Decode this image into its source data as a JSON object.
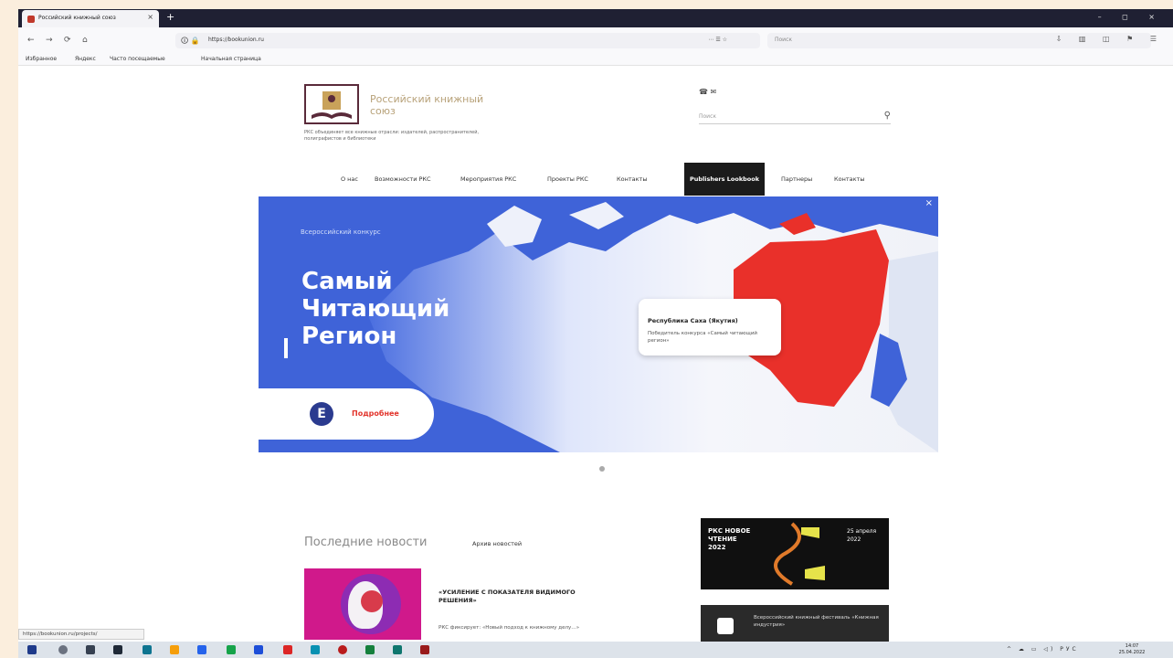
{
  "browser": {
    "tab_title": "Российский книжный союз",
    "tab_close": "×",
    "new_tab": "+",
    "window_controls": "– ◻ ×",
    "nav_buttons": [
      "←",
      "→",
      "⟳",
      "⌂"
    ],
    "url_icons": "🛈 🔒",
    "url": "https://bookunion.ru",
    "url_right": "⋯ ☰ ☆",
    "search_placeholder": "Поиск",
    "toolbar_icons": "⇩ ▥ ◫ ⚑ ☰",
    "bookmarks": [
      "Избранное",
      "Яндекс",
      "Часто посещаемые",
      "Начальная страница"
    ]
  },
  "site": {
    "logo_title": "Российский книжный союз",
    "logo_subtitle": "РКС объединяет все книжные отрасли: издателей, распространителей, полиграфистов и библиотеки",
    "header_icons": "☎ ✉",
    "search_placeholder": "Поиск",
    "search_icon": "⚲",
    "menu": [
      "О нас",
      "Возможности РКС",
      "Мероприятия РКС",
      "Проекты РКС",
      "Контакты",
      "Publishers Lookbook",
      "Партнеры",
      "Контакты"
    ]
  },
  "banner": {
    "label": "Всероссийский конкурс",
    "title": "Самый Читающий Регион",
    "close": "×",
    "callout_title": "Республика Саха (Якутия)",
    "callout_sub": "Победитель конкурса «Самый читающий регион»",
    "pill_icon": "Е",
    "pill_text": "Подробнее",
    "colors": {
      "blue": "#3f63d8",
      "red": "#e9302a"
    }
  },
  "news": {
    "title": "Последние новости",
    "all_link": "Архив новостей",
    "headline": "«УСИЛЕНИЕ С ПОКАЗАТЕЛЯ ВИДИМОГО РЕШЕНИЯ»",
    "text": "РКС фиксирует: «Новый подход к книжному делу…»"
  },
  "sidebar": {
    "banner1_text": "РКС НОВОЕ ЧТЕНИЕ 2022",
    "banner1_right": "25 апреля 2022",
    "banner2_text": "Всероссийский книжный фестиваль «Книжная индустрия»"
  },
  "status_url": "https://bookunion.ru/projects/",
  "taskbar": {
    "tray": "^ ☁ ▭ ◁) РУС",
    "clock_time": "14:07",
    "clock_date": "25.04.2022"
  }
}
